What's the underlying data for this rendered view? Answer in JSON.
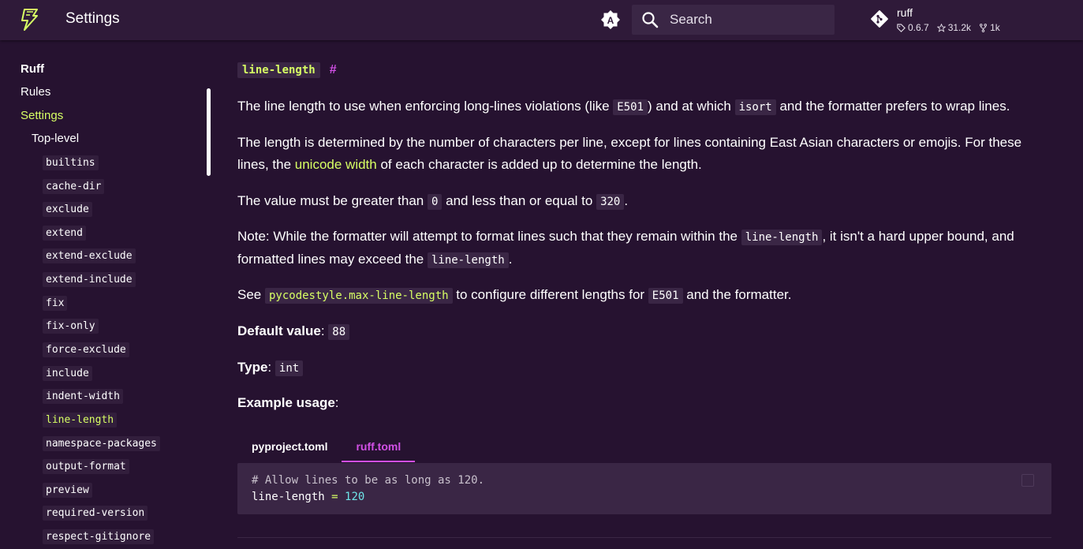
{
  "header": {
    "title": "Settings",
    "search_placeholder": "Search",
    "repo": {
      "name": "ruff",
      "version": "0.6.7",
      "stars": "31.2k",
      "forks": "1k"
    },
    "icons": {
      "logo": "ruff-bolt-logo-icon",
      "palette": "color-palette-icon",
      "search": "search-icon",
      "repo": "git-icon"
    }
  },
  "sidebar": {
    "top_items": [
      {
        "label": "Ruff"
      },
      {
        "label": "Rules"
      },
      {
        "label": "Settings"
      },
      {
        "label": "Top-level"
      }
    ],
    "settings": [
      "builtins",
      "cache-dir",
      "exclude",
      "extend",
      "extend-exclude",
      "extend-include",
      "fix",
      "fix-only",
      "force-exclude",
      "include",
      "indent-width",
      "line-length",
      "namespace-packages",
      "output-format",
      "preview",
      "required-version",
      "respect-gitignore"
    ]
  },
  "content": {
    "heading": "line-length",
    "headerlink": "#",
    "p1": {
      "a": "The line length to use when enforcing long-lines violations (like ",
      "c1": "E501",
      "b": ") and at which ",
      "c2": "isort",
      "c": " and the formatter prefers to wrap lines."
    },
    "p2": {
      "a": "The length is determined by the number of characters per line, except for lines containing East Asian characters or emojis. For these lines, the ",
      "link": "unicode width",
      "b": " of each character is added up to determine the length."
    },
    "p3": {
      "a": "The value must be greater than ",
      "c1": "0",
      "b": " and less than or equal to ",
      "c2": "320",
      "c": "."
    },
    "p4": {
      "a": "Note: While the formatter will attempt to format lines such that they remain within the ",
      "c1": "line-length",
      "b": ", it isn't a hard upper bound, and formatted lines may exceed the ",
      "c2": "line-length",
      "c": "."
    },
    "p5": {
      "a": "See ",
      "link": "pycodestyle.max-line-length",
      "b": " to configure different lengths for ",
      "c1": "E501",
      "c": " and the formatter."
    },
    "default": {
      "label": "Default value",
      "colon": ":",
      "value": "88"
    },
    "type": {
      "label": "Type",
      "colon": ":",
      "value": "int"
    },
    "example": {
      "label": "Example usage",
      "colon": ":"
    },
    "tabs": [
      {
        "label": "pyproject.toml",
        "active": false
      },
      {
        "label": "ruff.toml",
        "active": true
      }
    ],
    "code": {
      "comment": "# Allow lines to be as long as 120.",
      "key": "line-length",
      "op": "=",
      "value": "120"
    }
  },
  "colors": {
    "background": "#261230",
    "header": "#2f1a39",
    "accent": "#d7ff64",
    "link_accent": "#d250e6",
    "code_bg": "#3a2645"
  }
}
